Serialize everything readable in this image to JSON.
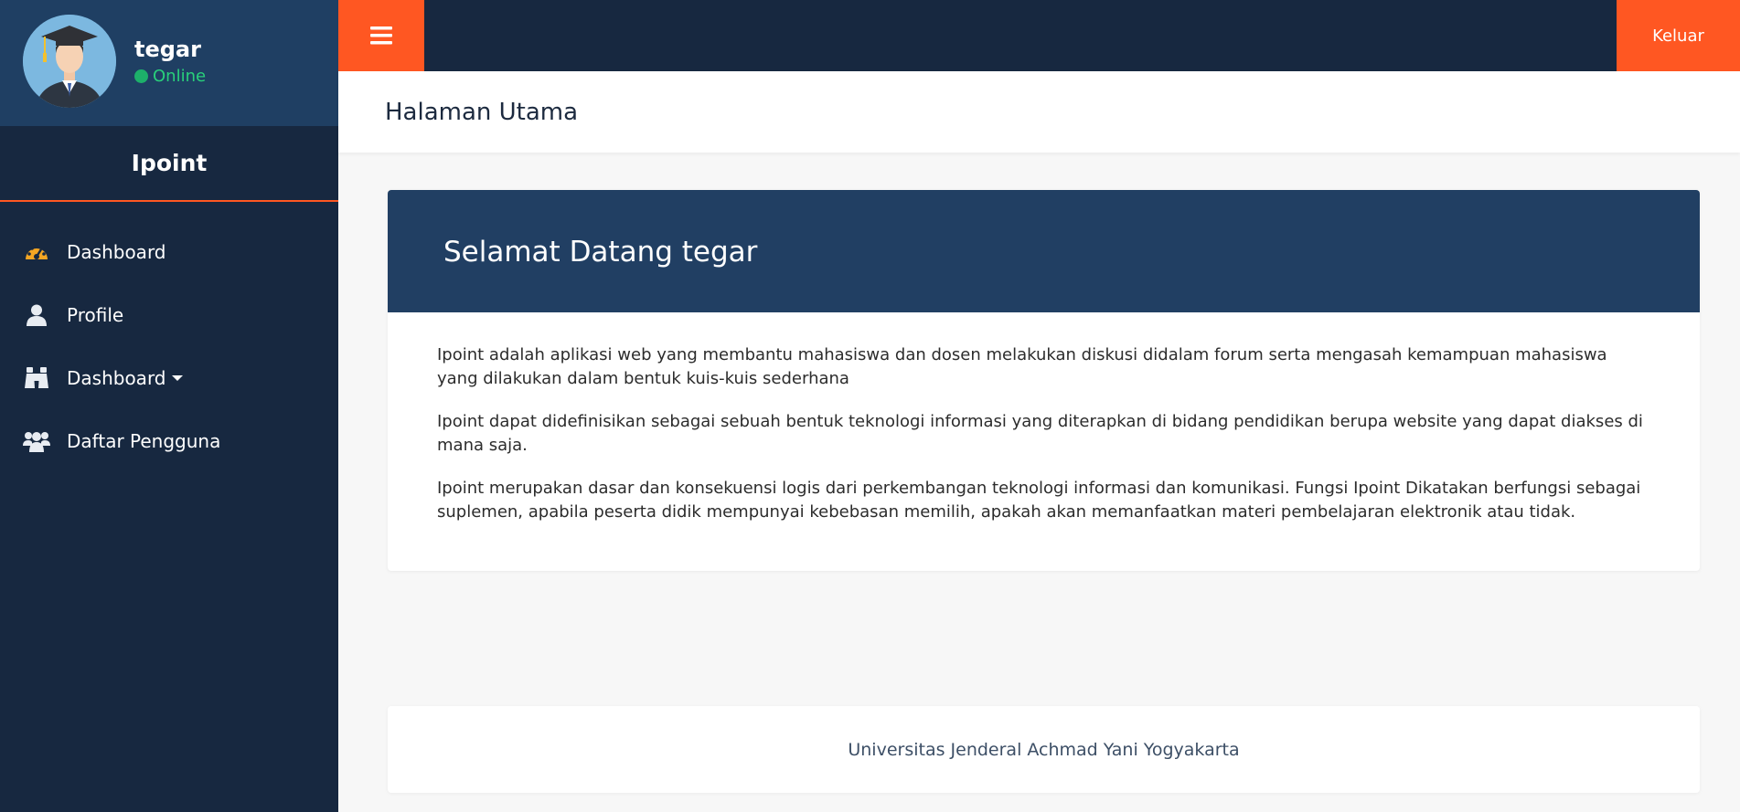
{
  "user": {
    "name": "tegar",
    "status": "Online"
  },
  "brand": "Ipoint",
  "nav": [
    {
      "label": "Dashboard",
      "icon": "tachometer-icon",
      "has_caret": false
    },
    {
      "label": "Profile",
      "icon": "user-icon",
      "has_caret": false
    },
    {
      "label": "Dashboard",
      "icon": "binoculars-icon",
      "has_caret": true
    },
    {
      "label": "Daftar Pengguna",
      "icon": "users-icon",
      "has_caret": false
    }
  ],
  "topbar": {
    "logout_label": "Keluar"
  },
  "page": {
    "title": "Halaman Utama"
  },
  "card": {
    "title": "Selamat Datang tegar",
    "paragraphs": [
      "Ipoint adalah aplikasi web yang membantu mahasiswa dan dosen melakukan diskusi didalam forum serta mengasah kemampuan mahasiswa yang dilakukan dalam bentuk kuis-kuis sederhana",
      "Ipoint dapat didefinisikan sebagai sebuah bentuk teknologi informasi yang diterapkan di bidang pendidikan berupa website yang dapat diakses di mana saja.",
      "Ipoint merupakan dasar dan konsekuensi logis dari perkembangan teknologi informasi dan komunikasi. Fungsi Ipoint Dikatakan berfungsi sebagai suplemen, apabila peserta didik mempunyai kebebasan memilih, apakah akan memanfaatkan materi pembelajaran elektronik atau tidak."
    ]
  },
  "footer": {
    "text": "Universitas Jenderal Achmad Yani Yogyakarta"
  },
  "colors": {
    "sidebar": "#172840",
    "user_panel": "#1f3f63",
    "accent": "#ff5722",
    "card_header": "#213f63",
    "online": "#29d07b"
  }
}
